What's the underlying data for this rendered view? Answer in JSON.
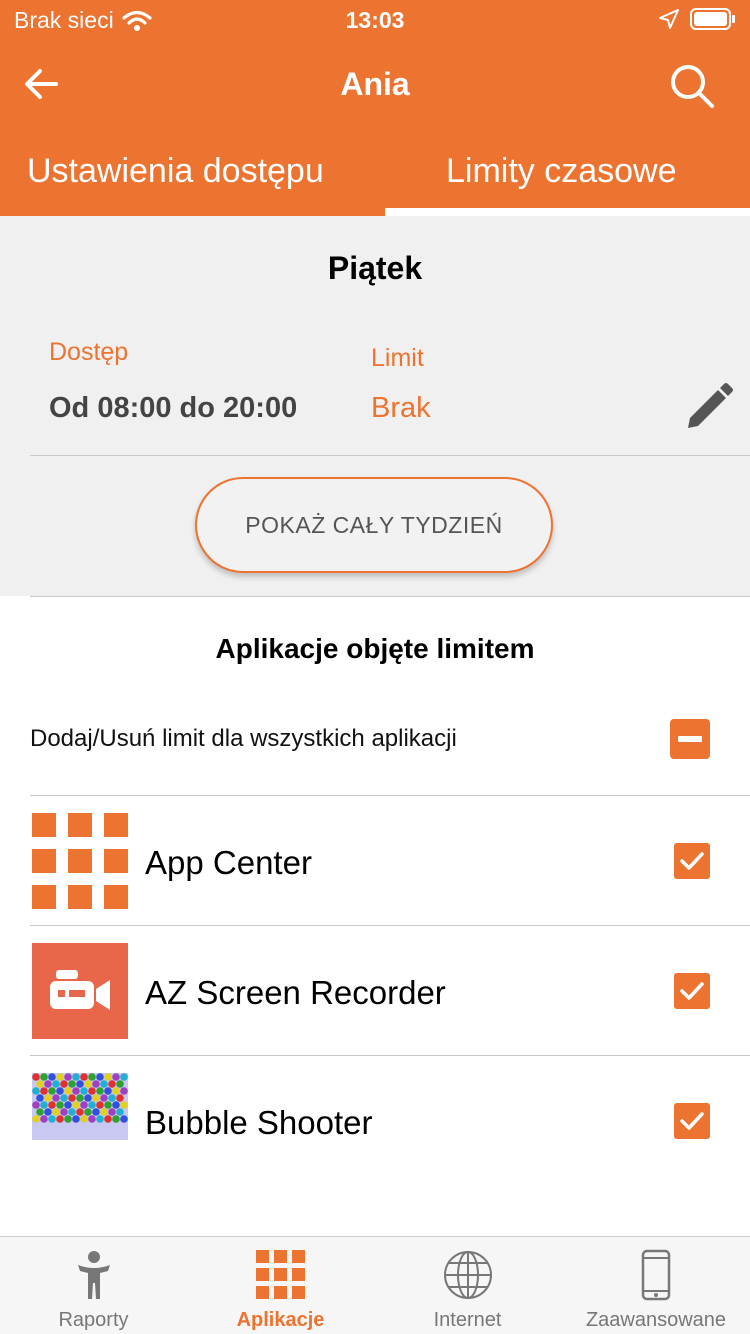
{
  "status_bar": {
    "carrier": "Brak sieci",
    "time": "13:03"
  },
  "header": {
    "title": "Ania"
  },
  "tabs": [
    {
      "label": "Ustawienia dostępu",
      "active": false
    },
    {
      "label": "Limity czasowe",
      "active": true
    }
  ],
  "day": {
    "title": "Piątek",
    "access_label": "Dostęp",
    "access_value": "Od 08:00 do 20:00",
    "limit_label": "Limit",
    "limit_value": "Brak",
    "show_week_button": "POKAŻ CAŁY TYDZIEŃ"
  },
  "apps": {
    "title": "Aplikacje objęte limitem",
    "toggle_all_label": "Dodaj/Usuń limit dla wszystkich aplikacji",
    "items": [
      {
        "name": "App Center",
        "icon": "app-center-icon",
        "checked": true
      },
      {
        "name": "AZ Screen Recorder",
        "icon": "az-screen-recorder-icon",
        "checked": true
      },
      {
        "name": "Bubble Shooter",
        "icon": "bubble-shooter-icon",
        "checked": true
      }
    ]
  },
  "bottom_nav": [
    {
      "label": "Raporty",
      "icon": "person-icon",
      "active": false
    },
    {
      "label": "Aplikacje",
      "icon": "apps-grid-icon",
      "active": true
    },
    {
      "label": "Internet",
      "icon": "globe-icon",
      "active": false
    },
    {
      "label": "Zaawansowane",
      "icon": "phone-icon",
      "active": false
    }
  ],
  "colors": {
    "accent": "#ed7330",
    "section_bg": "#f0f0f0",
    "recorder_bg": "#e8664a"
  }
}
